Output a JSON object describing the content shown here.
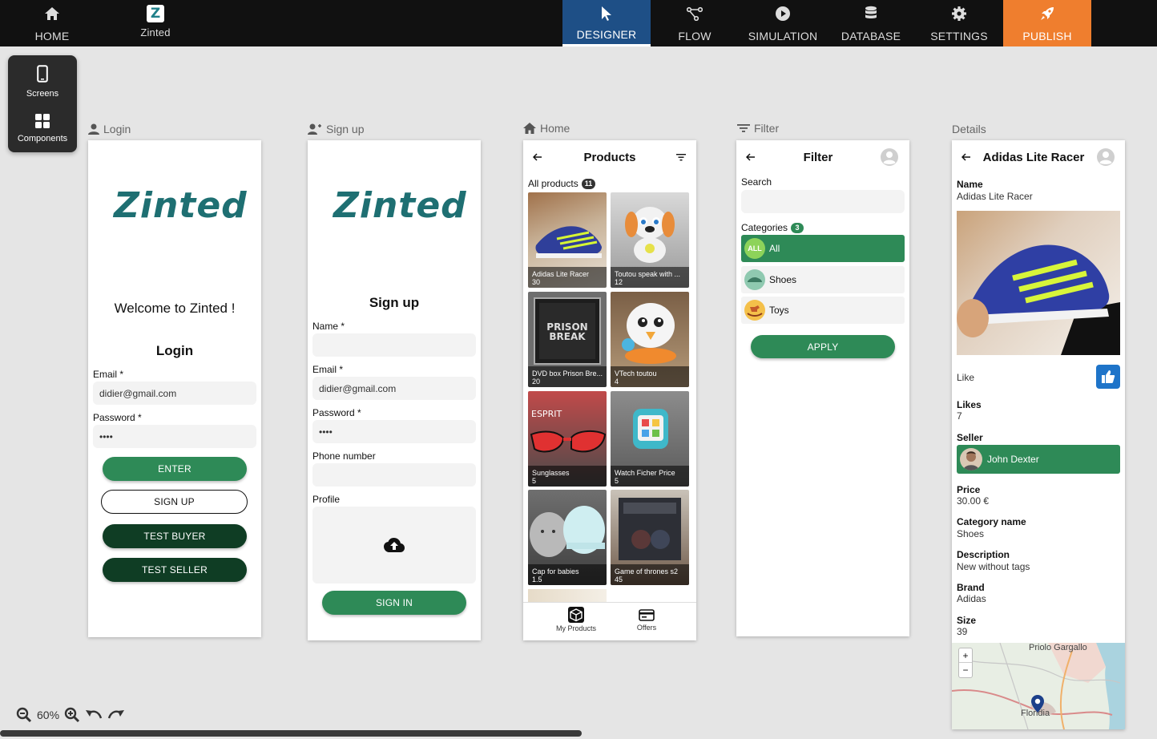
{
  "topbar": {
    "home": "HOME",
    "app_name": "Zinted",
    "app_logo": "Z",
    "designer": "DESIGNER",
    "flow": "FLOW",
    "simulation": "SIMULATION",
    "database": "DATABASE",
    "settings": "SETTINGS",
    "publish": "PUBLISH"
  },
  "flyout": {
    "screens": "Screens",
    "components": "Components"
  },
  "screens": {
    "login": {
      "caption": "Login",
      "brand": "Zinted",
      "welcome": "Welcome to Zinted !",
      "title": "Login",
      "email_label": "Email *",
      "email_value": "didier@gmail.com",
      "password_label": "Password *",
      "password_value": "••••",
      "enter": "ENTER",
      "sign_up": "SIGN UP",
      "test_buyer": "TEST BUYER",
      "test_seller": "TEST SELLER"
    },
    "signup": {
      "caption": "Sign up",
      "brand": "Zinted",
      "title": "Sign up",
      "name_label": "Name *",
      "email_label": "Email *",
      "email_value": "didier@gmail.com",
      "password_label": "Password *",
      "password_value": "••••",
      "phone_label": "Phone number",
      "profile_label": "Profile",
      "sign_in": "SIGN IN"
    },
    "home": {
      "caption": "Home",
      "title": "Products",
      "all_products": "All products",
      "count": "11",
      "products": [
        {
          "name": "Adidas Lite Racer",
          "price": "30"
        },
        {
          "name": "Toutou speak with ...",
          "price": "12"
        },
        {
          "name": "DVD box Prison Bre...",
          "price": "20"
        },
        {
          "name": "VTech toutou",
          "price": "4"
        },
        {
          "name": "Sunglasses",
          "price": "5"
        },
        {
          "name": "Watch Ficher Price",
          "price": "5"
        },
        {
          "name": "Cap for babies",
          "price": "1.5"
        },
        {
          "name": "Game of thrones s2",
          "price": "45"
        }
      ],
      "tab_my_products": "My Products",
      "tab_offers": "Offers"
    },
    "filter": {
      "caption": "Filter",
      "title": "Filter",
      "search_label": "Search",
      "categories_label": "Categories",
      "categories_count": "3",
      "categories": [
        {
          "name": "All",
          "avatar": "ALL"
        },
        {
          "name": "Shoes",
          "avatar": ""
        },
        {
          "name": "Toys",
          "avatar": ""
        }
      ],
      "apply": "APPLY"
    },
    "details": {
      "caption": "Details",
      "title": "Adidas Lite Racer",
      "name_label": "Name",
      "name_value": "Adidas Lite Racer",
      "like_label": "Like",
      "likes_label": "Likes",
      "likes_value": "7",
      "seller_label": "Seller",
      "seller_value": "John Dexter",
      "price_label": "Price",
      "price_value": "30.00 €",
      "category_label": "Category name",
      "category_value": "Shoes",
      "description_label": "Description",
      "description_value": "New without tags",
      "brand_label": "Brand",
      "brand_value": "Adidas",
      "size_label": "Size",
      "size_value": "39",
      "map_plus": "+",
      "map_minus": "−",
      "map_town1": "Priolo Gargallo",
      "map_town2": "Floridia"
    }
  },
  "zoom": {
    "level": "60%"
  },
  "colors": {
    "accent_green": "#2e8a57",
    "dark_green": "#0f3d24",
    "designer_blue": "#1e4f86",
    "publish_orange": "#ef7e2e"
  }
}
